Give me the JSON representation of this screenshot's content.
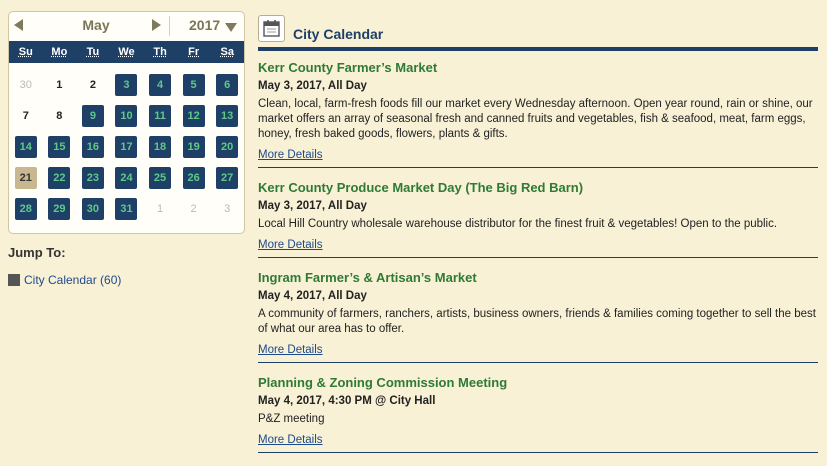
{
  "calendar": {
    "month": "May",
    "year": "2017",
    "weekdays": [
      "Su",
      "Mo",
      "Tu",
      "We",
      "Th",
      "Fr",
      "Sa"
    ],
    "days": [
      {
        "label": "30",
        "type": "other"
      },
      {
        "label": "1",
        "type": "plain"
      },
      {
        "label": "2",
        "type": "plain"
      },
      {
        "label": "3",
        "type": "ev"
      },
      {
        "label": "4",
        "type": "ev"
      },
      {
        "label": "5",
        "type": "ev"
      },
      {
        "label": "6",
        "type": "ev"
      },
      {
        "label": "7",
        "type": "plain"
      },
      {
        "label": "8",
        "type": "plain"
      },
      {
        "label": "9",
        "type": "ev"
      },
      {
        "label": "10",
        "type": "ev"
      },
      {
        "label": "11",
        "type": "ev"
      },
      {
        "label": "12",
        "type": "ev"
      },
      {
        "label": "13",
        "type": "ev"
      },
      {
        "label": "14",
        "type": "ev"
      },
      {
        "label": "15",
        "type": "ev"
      },
      {
        "label": "16",
        "type": "ev"
      },
      {
        "label": "17",
        "type": "ev"
      },
      {
        "label": "18",
        "type": "ev"
      },
      {
        "label": "19",
        "type": "ev"
      },
      {
        "label": "20",
        "type": "ev"
      },
      {
        "label": "21",
        "type": "today"
      },
      {
        "label": "22",
        "type": "ev"
      },
      {
        "label": "23",
        "type": "ev"
      },
      {
        "label": "24",
        "type": "ev"
      },
      {
        "label": "25",
        "type": "ev"
      },
      {
        "label": "26",
        "type": "ev"
      },
      {
        "label": "27",
        "type": "ev"
      },
      {
        "label": "28",
        "type": "ev"
      },
      {
        "label": "29",
        "type": "ev"
      },
      {
        "label": "30",
        "type": "ev"
      },
      {
        "label": "31",
        "type": "ev"
      },
      {
        "label": "1",
        "type": "other"
      },
      {
        "label": "2",
        "type": "other"
      },
      {
        "label": "3",
        "type": "other"
      }
    ]
  },
  "jump": {
    "label": "Jump To:",
    "item": "City Calendar (60)"
  },
  "main": {
    "title": "City Calendar",
    "events": [
      {
        "title": "Kerr County Farmer’s Market",
        "date": "May 3, 2017, All Day",
        "description": "Clean, local, farm-fresh foods fill our market every Wednesday afternoon. Open year round, rain or shine, our market offers an array of seasonal fresh and canned fruits and vegetables, fish & seafood, meat, farm eggs, honey, fresh baked goods, flowers, plants & gifts.",
        "more": "More Details"
      },
      {
        "title": "Kerr County Produce Market Day (The Big Red Barn)",
        "date": "May 3, 2017, All Day",
        "description": "Local Hill Country wholesale warehouse distributor for the finest fruit & vegetables! Open to the public.",
        "more": "More Details"
      },
      {
        "title": "Ingram Farmer’s & Artisan’s Market",
        "date": "May 4, 2017, All Day",
        "description": "A community of farmers, ranchers, artists, business owners, friends & families coming together to sell the best of what our area has to offer.",
        "more": "More Details"
      },
      {
        "title": "Planning & Zoning Commission Meeting",
        "date": "May 4, 2017, 4:30 PM @ City Hall",
        "description": "P&Z meeting",
        "more": "More Details"
      }
    ]
  },
  "colors": {
    "background": "#f8f1d6",
    "navy": "#1e3f66",
    "event_day_text": "#5ec98a",
    "today": "#c9b88f",
    "event_title": "#2f7a35",
    "link": "#1e4a8a"
  },
  "icons": {
    "prev": "triangle-left-icon",
    "next": "triangle-right-icon",
    "year_dropdown": "triangle-down-icon",
    "calendar": "calendar-icon",
    "category": "square-icon"
  }
}
